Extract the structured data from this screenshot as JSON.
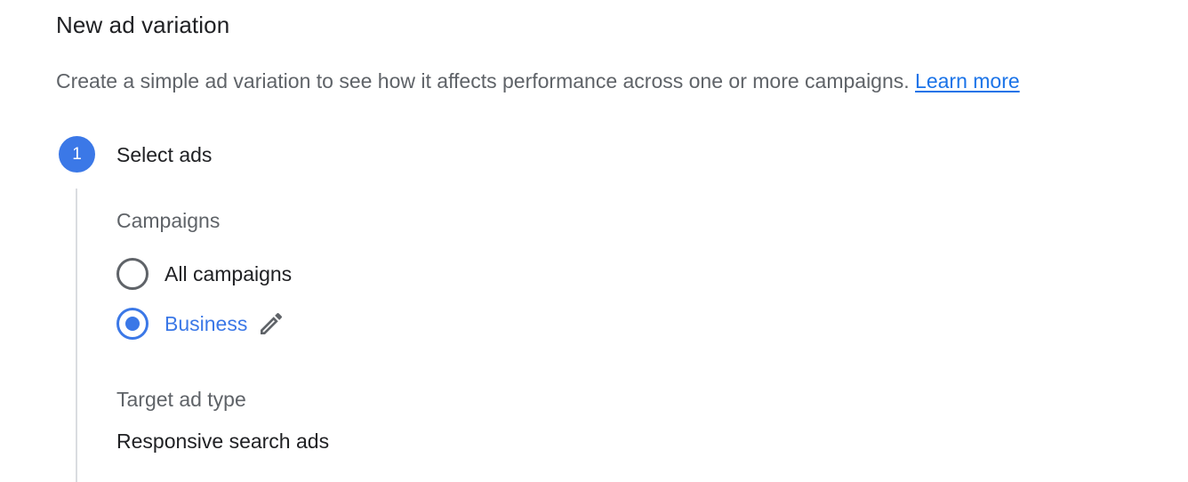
{
  "header": {
    "title": "New ad variation",
    "description": "Create a simple ad variation to see how it affects performance across one or more campaigns.",
    "learn_more": "Learn more"
  },
  "step": {
    "number": "1",
    "title": "Select ads"
  },
  "campaigns": {
    "label": "Campaigns",
    "options": [
      {
        "label": "All campaigns",
        "selected": false
      },
      {
        "label": "Business",
        "selected": true,
        "icon": "pencil-edit-icon"
      }
    ]
  },
  "target_ad_type": {
    "label": "Target ad type",
    "value": "Responsive search ads"
  },
  "colors": {
    "accent": "#3b78e7",
    "link": "#1a73e8",
    "text_primary": "#202124",
    "text_secondary": "#5f6368",
    "divider": "#dadce0"
  }
}
